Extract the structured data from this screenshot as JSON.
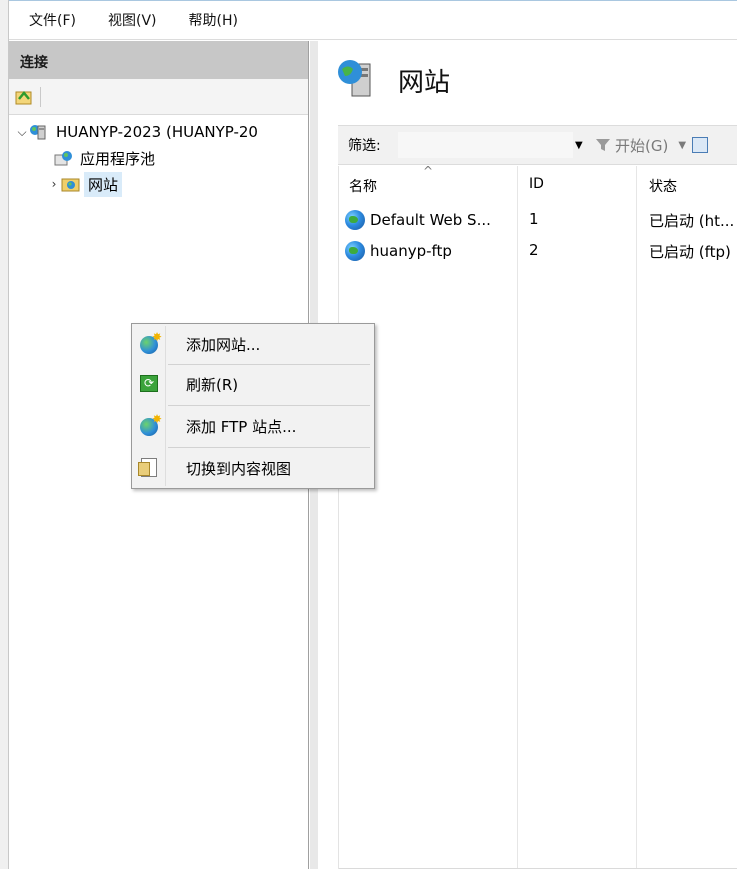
{
  "menubar": {
    "items": [
      "文件(F)",
      "视图(V)",
      "帮助(H)"
    ]
  },
  "connections": {
    "title": "连接",
    "tree": {
      "server": "HUANYP-2023 (HUANYP-20",
      "app_pools": "应用程序池",
      "sites": "网站"
    }
  },
  "main": {
    "title": "网站",
    "filter": {
      "label": "筛选:",
      "value": "",
      "start_label": "开始(G)"
    },
    "columns": [
      "名称",
      "ID",
      "状态"
    ],
    "rows": [
      {
        "name": "Default Web S...",
        "id": "1",
        "status": "已启动 (ht..."
      },
      {
        "name": "huanyp-ftp",
        "id": "2",
        "status": "已启动 (ftp)"
      }
    ]
  },
  "context_menu": {
    "items": [
      "添加网站...",
      "刷新(R)",
      "添加 FTP 站点...",
      "切换到内容视图"
    ]
  },
  "icons": {
    "add_site": "globe-add-icon",
    "refresh": "refresh-icon",
    "add_ftp": "globe-add-icon",
    "content_view": "content-view-icon"
  }
}
